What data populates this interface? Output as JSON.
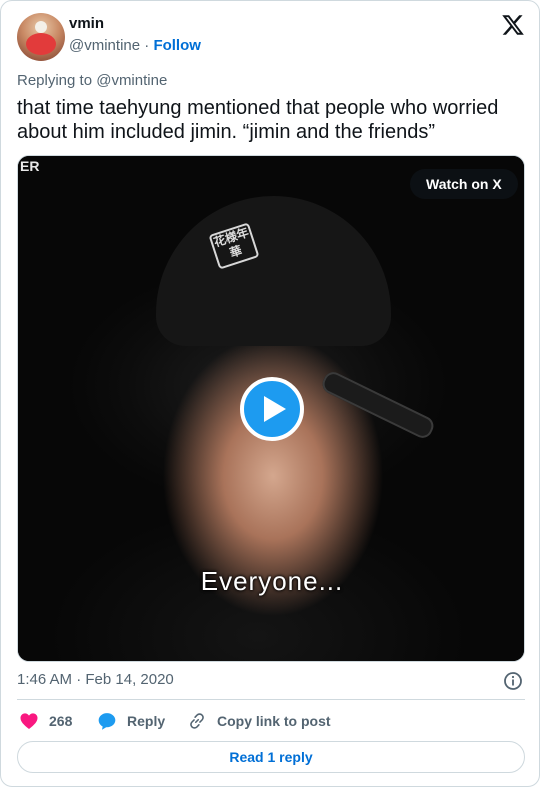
{
  "author": {
    "name": "vmin",
    "handle": "@vmintine",
    "separator": "·",
    "follow_label": "Follow"
  },
  "replying_to": "Replying to @vmintine",
  "tweet": {
    "text": "that time taehyung mentioned that people who worried about him included jimin. “jimin and the friends”"
  },
  "media": {
    "watch_label": "Watch on X",
    "corner_text": "ER",
    "subtitle": "Everyone...",
    "patch_text": "花様年華"
  },
  "timestamp": "1:46 AM · Feb 14, 2020",
  "actions": {
    "like_count": "268",
    "reply_label": "Reply",
    "copy_label": "Copy link to post"
  },
  "read_replies_label": "Read 1 reply",
  "colors": {
    "accent": "#1d9bf0",
    "link": "#006fd6",
    "like": "#f91880",
    "muted": "#536471",
    "border": "#cfd9de"
  },
  "icons": [
    "x-logo-icon",
    "play-icon",
    "info-icon",
    "heart-icon",
    "reply-bubble-icon",
    "link-icon"
  ]
}
